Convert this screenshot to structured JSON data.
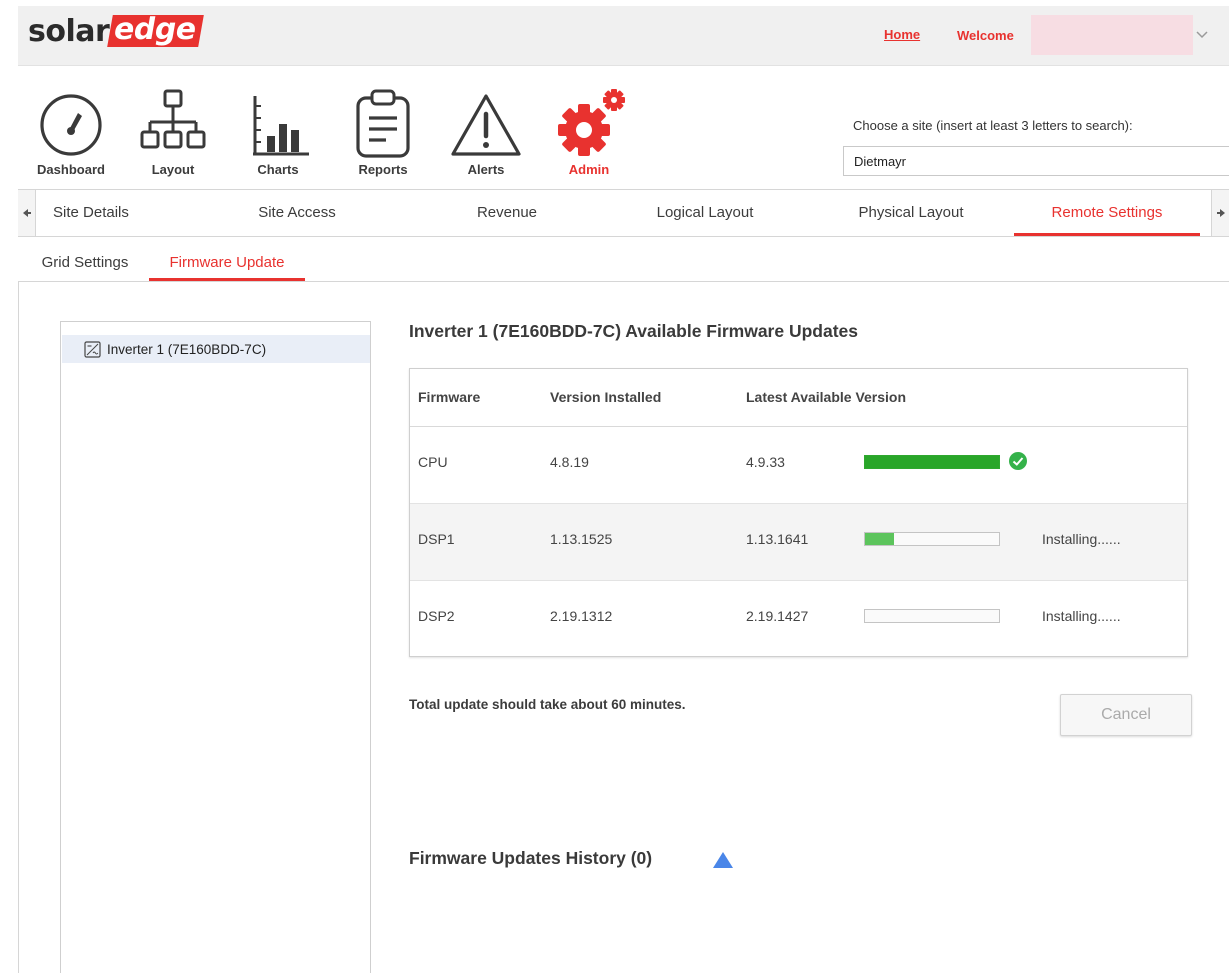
{
  "header": {
    "logo": {
      "part1": "solar",
      "part2": "edge"
    },
    "home_link": "Home",
    "welcome_label": "Welcome"
  },
  "nav": {
    "items": [
      {
        "label": "Dashboard",
        "icon": "dashboard-gauge-icon"
      },
      {
        "label": "Layout",
        "icon": "layout-hierarchy-icon"
      },
      {
        "label": "Charts",
        "icon": "bar-chart-icon"
      },
      {
        "label": "Reports",
        "icon": "clipboard-report-icon"
      },
      {
        "label": "Alerts",
        "icon": "warning-triangle-icon"
      },
      {
        "label": "Admin",
        "icon": "gear-icon",
        "active": true
      }
    ]
  },
  "site_search": {
    "label": "Choose a site (insert at least 3 letters to search):",
    "value": "Dietmayr"
  },
  "tabs": [
    {
      "label": "Site Details"
    },
    {
      "label": "Site Access"
    },
    {
      "label": "Revenue"
    },
    {
      "label": "Logical Layout"
    },
    {
      "label": "Physical Layout"
    },
    {
      "label": "Remote Settings",
      "active": true
    }
  ],
  "subtabs": [
    {
      "label": "Grid Settings"
    },
    {
      "label": "Firmware Update",
      "active": true
    }
  ],
  "tree": {
    "items": [
      {
        "label": "Inverter 1 (7E160BDD-7C)",
        "icon": "inverter-icon"
      }
    ]
  },
  "firmware": {
    "title": "Inverter 1 (7E160BDD-7C) Available Firmware Updates",
    "columns": [
      "Firmware",
      "Version Installed",
      "Latest Available Version"
    ],
    "rows": [
      {
        "name": "CPU",
        "installed": "4.8.19",
        "latest": "4.9.33",
        "progress": 1.0,
        "status": "",
        "complete": true
      },
      {
        "name": "DSP1",
        "installed": "1.13.1525",
        "latest": "1.13.1641",
        "progress": 0.22,
        "status": "Installing......",
        "complete": false
      },
      {
        "name": "DSP2",
        "installed": "2.19.1312",
        "latest": "2.19.1427",
        "progress": 0.0,
        "status": "Installing......",
        "complete": false
      }
    ],
    "note": "Total update should take about 60 minutes.",
    "cancel_label": "Cancel"
  },
  "history": {
    "title": "Firmware Updates History (0)"
  },
  "colors": {
    "brand_red": "#e8322f",
    "progress_green": "#29a629",
    "progress_light_green": "#5cc45c",
    "history_arrow_blue": "#4a86e8"
  }
}
